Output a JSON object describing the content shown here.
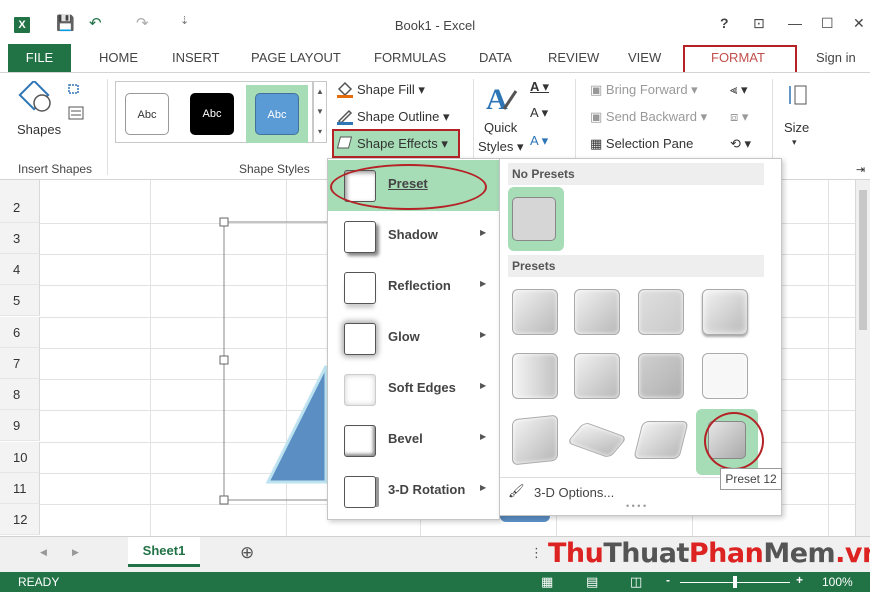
{
  "window": {
    "title": "Book1 - Excel",
    "help": "?",
    "ribbon_display": "⊡",
    "minimize": "—",
    "restore": "☐",
    "close": "✕"
  },
  "qat": {
    "save": "💾",
    "undo": "↶",
    "redo": "↷",
    "customize": "⇣"
  },
  "tabs": {
    "file": "FILE",
    "items": [
      "HOME",
      "INSERT",
      "PAGE LAYOUT",
      "FORMULAS",
      "DATA",
      "REVIEW",
      "VIEW",
      "FORMAT"
    ],
    "sign_in": "Sign in"
  },
  "ribbon": {
    "insert_shapes": {
      "label": "Insert Shapes",
      "shapes_label": "Shapes"
    },
    "shape_styles": {
      "label": "Shape Styles",
      "swatches": [
        "Abc",
        "Abc",
        "Abc"
      ],
      "fill": "Shape Fill",
      "outline": "Shape Outline",
      "effects": "Shape Effects"
    },
    "wordart": {
      "quick_styles_1": "Quick",
      "quick_styles_2": "Styles"
    },
    "arrange": {
      "bring_forward": "Bring Forward",
      "send_backward": "Send Backward",
      "selection_pane": "Selection Pane"
    },
    "size": {
      "label": "Size"
    }
  },
  "rows": [
    "2",
    "3",
    "4",
    "5",
    "6",
    "7",
    "8",
    "9",
    "10",
    "11",
    "12"
  ],
  "effects_menu": [
    "Preset",
    "Shadow",
    "Reflection",
    "Glow",
    "Soft Edges",
    "Bevel",
    "3-D Rotation"
  ],
  "preset_submenu": {
    "no_presets": "No Presets",
    "presets": "Presets",
    "options": "3-D Options...",
    "tooltip": "Preset 12"
  },
  "sheet": {
    "tab": "Sheet1",
    "add": "⊕",
    "nav_left": "◀",
    "nav_right": "▶"
  },
  "status": {
    "ready": "READY",
    "zoom_minus": "-",
    "zoom_plus": "+",
    "zoom": "100%"
  },
  "watermark": {
    "thu": "Thu",
    "thuat": "Thuat",
    "phan": "Phan",
    "mem": "Mem",
    "vn": ".vn"
  },
  "colors": {
    "accent": "#217346",
    "highlight": "#a6dcb6",
    "callout": "#b52226",
    "shape_fill": "#5b8fc4"
  }
}
